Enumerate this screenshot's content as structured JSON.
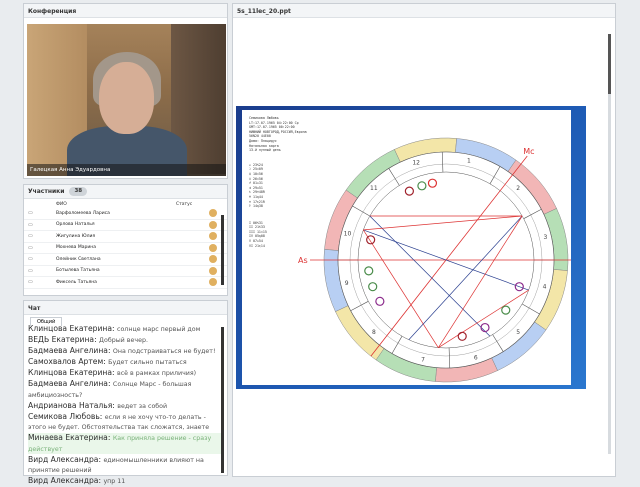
{
  "conference": {
    "title": "Конференция",
    "speaker_name": "Галецкая Анна Эдуардовна"
  },
  "participants": {
    "title": "Участники",
    "count": "38",
    "col_name": "ФИО",
    "col_status": "Статус",
    "rows": [
      {
        "name": "Варфоломеева Лариса"
      },
      {
        "name": "Орлова Наталья"
      },
      {
        "name": "Жигулина Юлия"
      },
      {
        "name": "Мохнева Марина"
      },
      {
        "name": "Олейник Светлана"
      },
      {
        "name": "Ботылева Татьяна"
      },
      {
        "name": "Фиксель Татьяна"
      }
    ]
  },
  "chat": {
    "title": "Чат",
    "tab": "Общий",
    "messages": [
      {
        "author": "Клинцова Екатерина:",
        "text": "солнце марс первый дом"
      },
      {
        "author": "ВЕДЬ Екатерина:",
        "text": "Добрый вечер."
      },
      {
        "author": "Бадмаева Ангелина:",
        "text": "Она подстраиваться не будет!"
      },
      {
        "author": "Самохвалов Артем:",
        "text": "Будет сильно пытаться"
      },
      {
        "author": "Клинцова Екатерина:",
        "text": "всё в рамках приличия)"
      },
      {
        "author": "Бадмаева Ангелина:",
        "text": "Солнце  Марс - большая амбициозность?"
      },
      {
        "author": "Андрианова Наталья:",
        "text": "ведет за собой"
      },
      {
        "author": "Семикова Любовь:",
        "text": "если я не хочу что-то делать - этого не будет. Обстоятельства так сложатся, знаете"
      },
      {
        "author": "Минаева Екатерина:",
        "text": "Как приняла решение - сразу действует",
        "highlight": true
      },
      {
        "author": "Вирд Александра:",
        "text": "единомышленники влияют на принятие решений"
      },
      {
        "author": "Вирд Александра:",
        "text": "упр 11"
      }
    ]
  },
  "presentation": {
    "file": "5s_11lec_20.ppt",
    "chart_header": [
      "Семикова Любовь",
      "LT:17.07.1965 04:22:00 Ср",
      "GMT:17.07.1965 00:22:00",
      "НИЖНИЙ НОВГОРОД,РОССИЯ,Европа",
      "56N20   44E00",
      "Дома: Плацидус",
      "Натальная карта",
      "13-й лунный день"
    ],
    "planet_list": [
      "☉ 23♋24",
      "☽ 25♌09",
      "☿ 10♌56",
      "♀ 26♌56",
      "♂ 01♎31",
      "♃ 29♊51",
      "♄ 29♓48R",
      "♅ 11♍44",
      "♆ 17♏21R",
      "♇ 14♍38"
    ],
    "house_list": [
      "I 06♋31",
      "II 21♋33",
      "III 11♌15",
      "IV 05♍08",
      "V 07♎54",
      "VI 21♏14"
    ],
    "chart_labels": {
      "asc": "As",
      "mc": "Mc"
    },
    "house_numbers": [
      "1",
      "2",
      "3",
      "4",
      "5",
      "6",
      "7",
      "8",
      "9",
      "10",
      "11",
      "12"
    ],
    "zodiac_colors": {
      "fire": "#f2b6b6",
      "earth": "#b6dfb6",
      "air": "#f3e6a8",
      "water": "#b8cff3"
    }
  }
}
